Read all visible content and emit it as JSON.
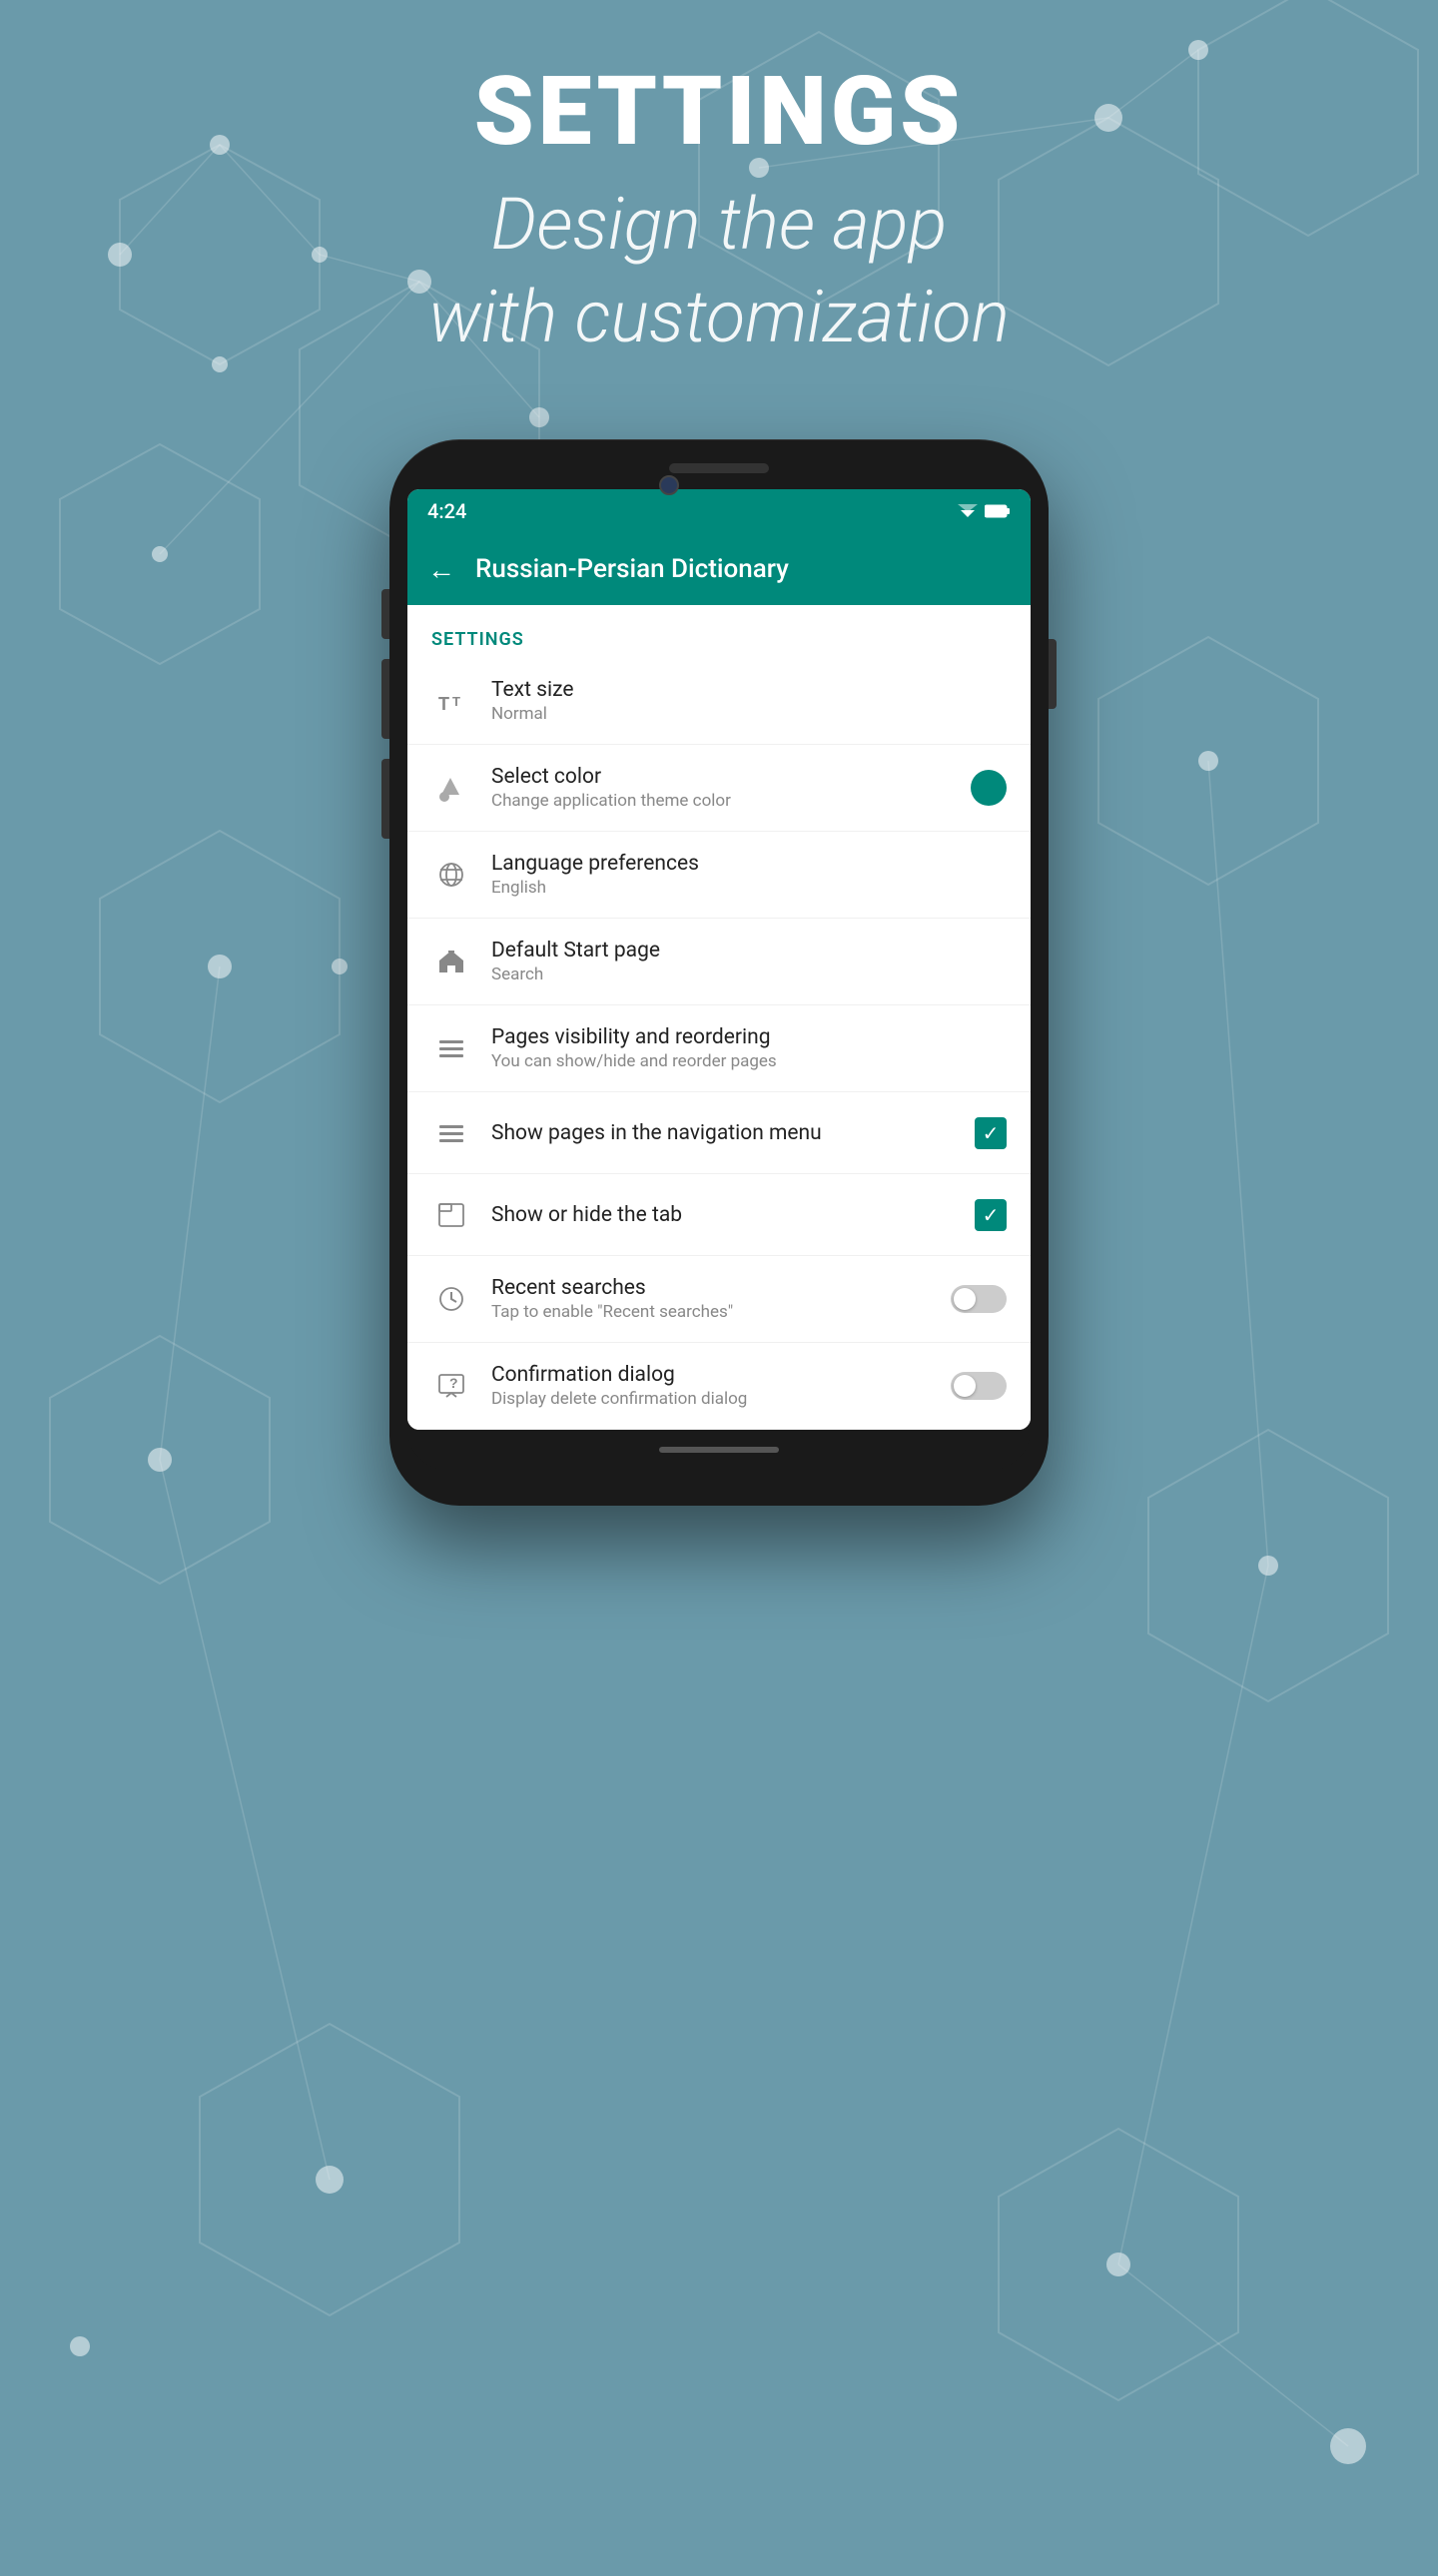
{
  "background": {
    "color": "#6a9aaa"
  },
  "header": {
    "title": "SETTINGS",
    "subtitle_line1": "Design the app",
    "subtitle_line2": "with customization"
  },
  "status_bar": {
    "time": "4:24",
    "accent_color": "#00897b"
  },
  "top_bar": {
    "title": "Russian-Persian Dictionary",
    "back_label": "←"
  },
  "section_title": "SETTINGS",
  "settings": [
    {
      "id": "text-size",
      "icon": "text-size-icon",
      "label": "Text size",
      "sublabel": "Normal",
      "control": "none"
    },
    {
      "id": "select-color",
      "icon": "color-icon",
      "label": "Select color",
      "sublabel": "Change application theme color",
      "control": "color-dot",
      "control_color": "#00897b"
    },
    {
      "id": "language",
      "icon": "globe-icon",
      "label": "Language preferences",
      "sublabel": "English",
      "control": "none"
    },
    {
      "id": "start-page",
      "icon": "home-icon",
      "label": "Default Start page",
      "sublabel": "Search",
      "control": "none"
    },
    {
      "id": "pages-visibility",
      "icon": "menu-icon",
      "label": "Pages visibility and reordering",
      "sublabel": "You can show/hide and reorder pages",
      "control": "none"
    },
    {
      "id": "show-pages-nav",
      "icon": "menu-icon",
      "label": "Show pages in the navigation menu",
      "sublabel": "",
      "control": "checkbox",
      "checked": true
    },
    {
      "id": "show-tab",
      "icon": "tab-icon",
      "label": "Show or hide the tab",
      "sublabel": "",
      "control": "checkbox",
      "checked": true
    },
    {
      "id": "recent-searches",
      "icon": "history-icon",
      "label": "Recent searches",
      "sublabel": "Tap to enable \"Recent searches\"",
      "control": "toggle",
      "toggled": false
    },
    {
      "id": "confirmation-dialog",
      "icon": "dialog-icon",
      "label": "Confirmation dialog",
      "sublabel": "Display delete confirmation dialog",
      "control": "toggle",
      "toggled": false
    }
  ]
}
